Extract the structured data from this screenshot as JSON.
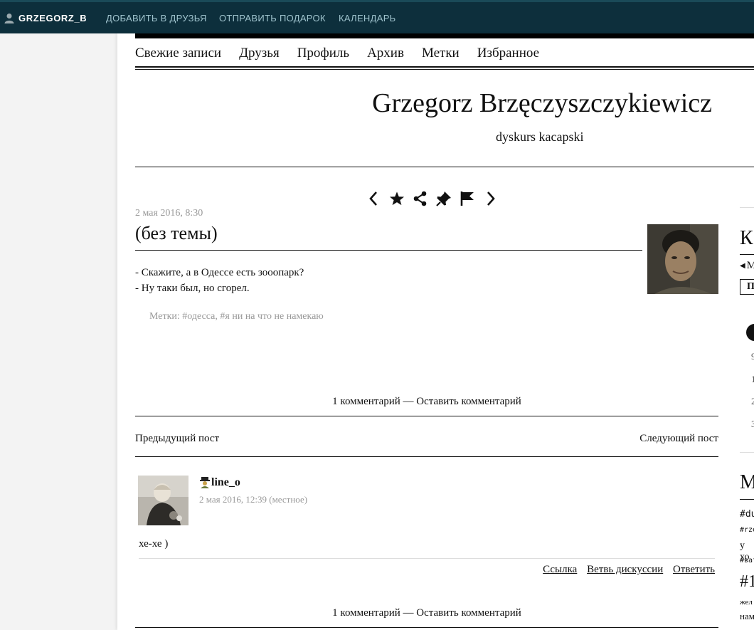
{
  "topbar": {
    "username": "GRZEGORZ_B",
    "add_friend": "ДОБАВИТЬ В ДРУЗЬЯ",
    "send_gift": "ОТПРАВИТЬ ПОДАРОК",
    "calendar": "КАЛЕНДАРЬ"
  },
  "nav": {
    "items": [
      "Свежие записи",
      "Друзья",
      "Профиль",
      "Архив",
      "Метки",
      "Избранное"
    ]
  },
  "blog": {
    "title": "Grzegorz Brzęczyszczykiewicz",
    "subtitle": "dyskurs kacapski"
  },
  "entry": {
    "date": "2 мая 2016, 8:30",
    "title": "(без темы)",
    "body_lines": [
      "- Скажите, а в Одессе есть зооопарк?",
      "- Ну таки был, но сгорел."
    ],
    "tags_label": "Метки:",
    "tags": [
      "#одесса",
      "#я ни на что не намекаю"
    ],
    "comment_count": "1 комментарий",
    "separator": "—",
    "leave_comment": "Оставить комментарий",
    "prev_post": "Предыдущий пост",
    "next_post": "Следующий пост"
  },
  "tools": [
    "chevron-left-icon",
    "star-icon",
    "share-icon",
    "pin-icon",
    "flag-icon",
    "chevron-right-icon"
  ],
  "comment": {
    "username": "line_o",
    "date": "2 мая 2016, 12:39",
    "local": "(местное)",
    "text": "хе-хе )",
    "actions": [
      "Ссылка",
      "Ветвь дискуссии",
      "Ответить"
    ]
  },
  "sidebar": {
    "heading1": "К",
    "nav_fragment": "М",
    "tab_fragment": "П",
    "numbers": [
      "9",
      "1",
      "2",
      "3"
    ],
    "heading2": "М",
    "text_fragments": [
      "#du",
      "#rze",
      "у хо",
      "#ват"
    ],
    "heading3": "#1",
    "more_fragments": [
      "жел",
      "нам"
    ]
  },
  "colors": {
    "topbar_bg": "#0d2f3c",
    "topbar_link": "#9fc3cd",
    "meta_gray": "#999999"
  }
}
